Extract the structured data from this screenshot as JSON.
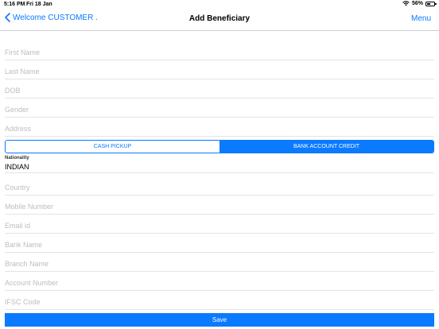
{
  "status_bar": {
    "time": "5:16 PM",
    "date": "Fri 18 Jan",
    "battery_percent": "56%",
    "battery_level": 0.56,
    "icons": [
      "wifi-icon",
      "battery-icon"
    ]
  },
  "nav": {
    "back_label": "Welcome CUSTOMER .",
    "title": "Add Beneficiary",
    "menu_label": "Menu",
    "back_icon": "chevron-left-icon"
  },
  "fields_top": [
    {
      "placeholder": "First Name",
      "value": ""
    },
    {
      "placeholder": "Last Name",
      "value": ""
    },
    {
      "placeholder": "DOB",
      "value": ""
    },
    {
      "placeholder": "Gender",
      "value": ""
    },
    {
      "placeholder": "Address",
      "value": ""
    }
  ],
  "segmented": {
    "options": [
      "CASH PICKUP",
      "BANK ACCOUNT CREDIT"
    ],
    "selected": "BANK ACCOUNT CREDIT"
  },
  "nationality": {
    "label": "Nationality",
    "value": "INDIAN"
  },
  "fields_bottom": [
    {
      "placeholder": "Country",
      "value": ""
    },
    {
      "placeholder": "Mobile Number",
      "value": ""
    },
    {
      "placeholder": "Email id",
      "value": ""
    },
    {
      "placeholder": "Bank Name",
      "value": ""
    },
    {
      "placeholder": "Branch Name",
      "value": ""
    },
    {
      "placeholder": "Account Number",
      "value": ""
    },
    {
      "placeholder": "IFSC Code",
      "value": ""
    }
  ],
  "save_label": "Save",
  "colors": {
    "accent": "#0a7aff",
    "placeholder": "#bdbdc2",
    "divider": "#e4e4e4"
  }
}
